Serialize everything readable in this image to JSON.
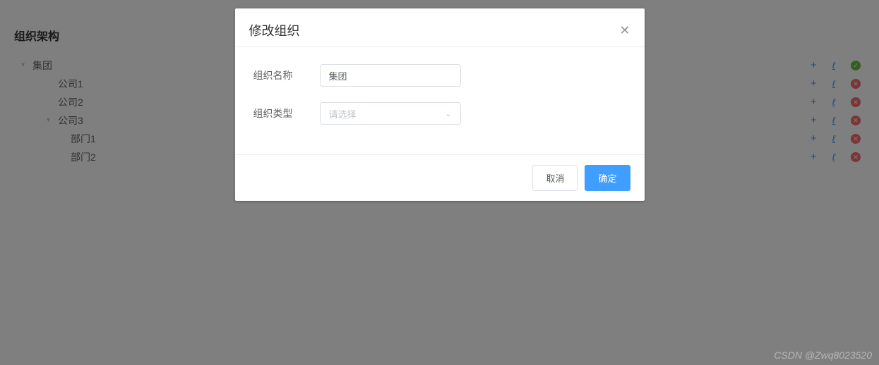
{
  "page": {
    "title": "组织架构"
  },
  "tree": {
    "nodes": [
      {
        "label": "集团",
        "indent": 1,
        "expanded": true,
        "hasCaret": true,
        "status": "green"
      },
      {
        "label": "公司1",
        "indent": 2,
        "expanded": false,
        "hasCaret": false,
        "status": "red"
      },
      {
        "label": "公司2",
        "indent": 2,
        "expanded": false,
        "hasCaret": false,
        "status": "red"
      },
      {
        "label": "公司3",
        "indent": 2,
        "expanded": true,
        "hasCaret": true,
        "status": "red"
      },
      {
        "label": "部门1",
        "indent": 3,
        "expanded": false,
        "hasCaret": false,
        "status": "red"
      },
      {
        "label": "部门2",
        "indent": 3,
        "expanded": false,
        "hasCaret": false,
        "status": "red"
      }
    ]
  },
  "modal": {
    "title": "修改组织",
    "fields": {
      "name": {
        "label": "组织名称",
        "value": "集团"
      },
      "type": {
        "label": "组织类型",
        "placeholder": "请选择"
      }
    },
    "buttons": {
      "cancel": "取消",
      "confirm": "确定"
    }
  },
  "watermark": "CSDN @Zwq8023520"
}
